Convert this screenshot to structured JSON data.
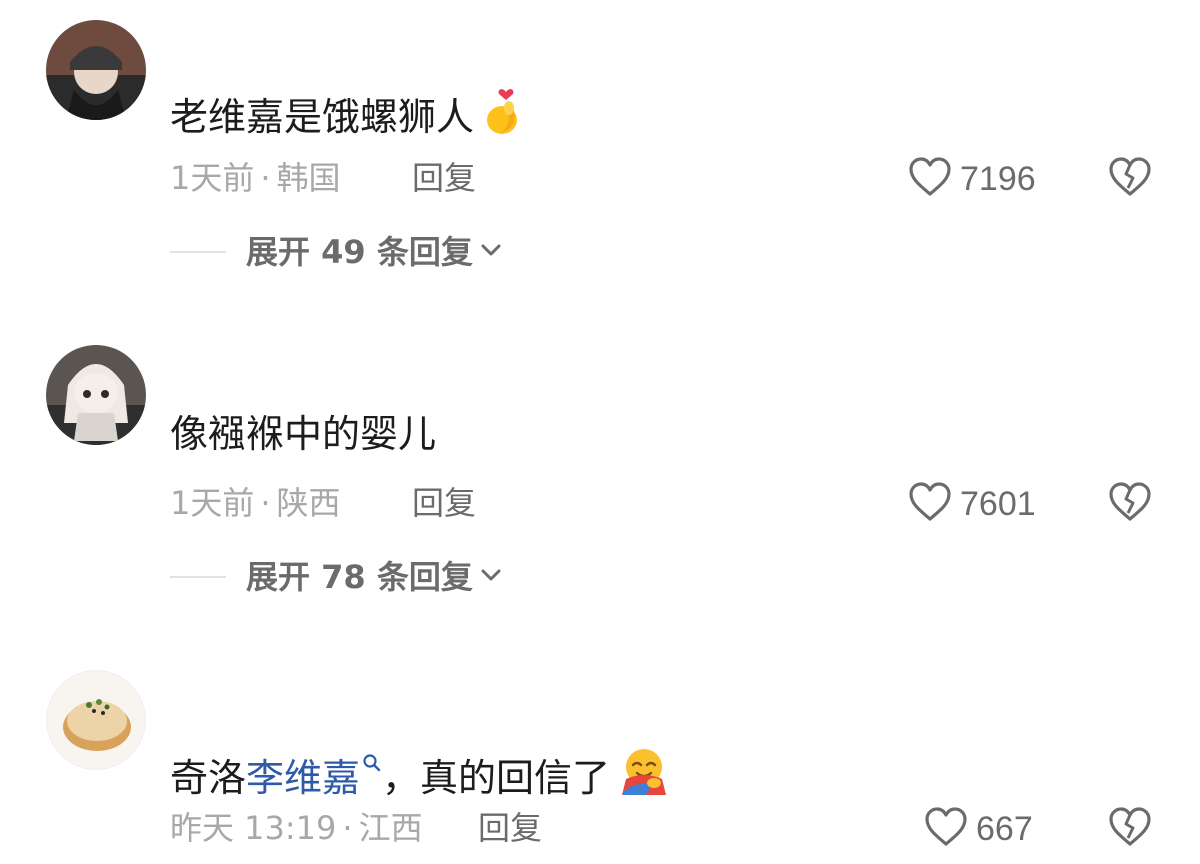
{
  "comments": [
    {
      "text": "老维嘉是饿螺狮人",
      "emoji_icon": "finger-heart-emoji",
      "time": "1天前",
      "location": "韩国",
      "reply_label": "回复",
      "likes": "7196",
      "expand_label": "展开 49 条回复"
    },
    {
      "text": "像襁褓中的婴儿",
      "time": "1天前",
      "location": "陕西",
      "reply_label": "回复",
      "likes": "7601",
      "expand_label": "展开 78 条回复"
    },
    {
      "text_before": "奇洛",
      "mention": "李维嘉",
      "text_after": "，真的回信了",
      "emoji_icon": "hugging-emoji",
      "time": "昨天 13:19",
      "location": "江西",
      "reply_label": "回复",
      "likes": "667"
    }
  ],
  "icons": {
    "like": "heart-outline-icon",
    "dislike": "broken-heart-icon",
    "expand": "chevron-down-icon",
    "mention_search": "search-icon"
  },
  "colors": {
    "mention": "#2f5aa7",
    "meta": "#a8a8a8",
    "action": "#6b6b6b"
  }
}
